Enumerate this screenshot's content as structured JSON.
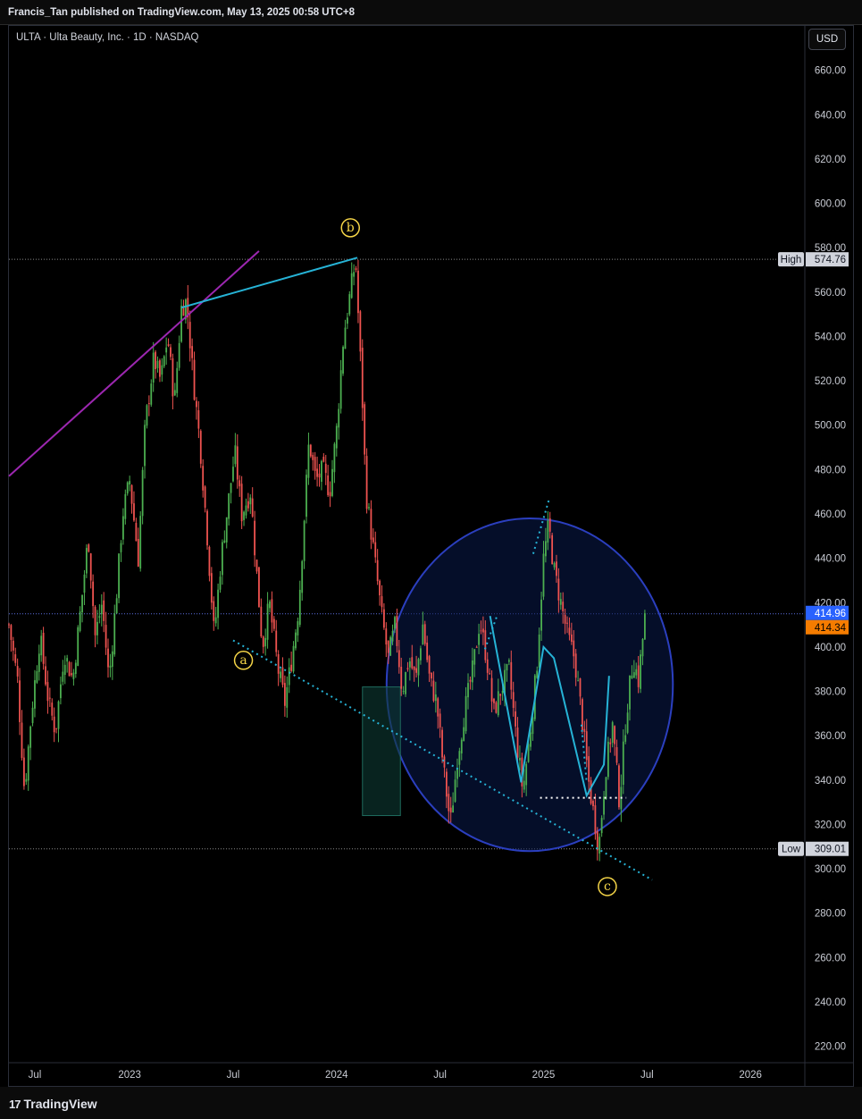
{
  "header": {
    "published_text": "Francis_Tan published on TradingView.com, May 13, 2025 00:58 UTC+8",
    "symbol_text": "ULTA · Ulta Beauty, Inc. · 1D · NASDAQ",
    "currency_button": "USD"
  },
  "footer": {
    "logo_text": "TradingView"
  },
  "chart_data": {
    "type": "candlestick",
    "symbol": "ULTA",
    "interval": "1D",
    "exchange": "NASDAQ",
    "y_ticks": [
      660,
      640,
      620,
      600,
      580,
      560,
      540,
      520,
      500,
      480,
      460,
      440,
      420,
      400,
      380,
      360,
      340,
      320,
      300,
      280,
      260,
      240,
      220
    ],
    "y_tick_labels": [
      "660.00",
      "640.00",
      "620.00",
      "600.00",
      "580.00",
      "560.00",
      "540.00",
      "520.00",
      "500.00",
      "480.00",
      "460.00",
      "440.00",
      "420.00",
      "400.00",
      "380.00",
      "360.00",
      "340.00",
      "320.00",
      "300.00",
      "280.00",
      "260.00",
      "240.00",
      "220.00"
    ],
    "x_tick_labels": [
      "Jul",
      "2023",
      "Jul",
      "2024",
      "Jul",
      "2025",
      "Jul",
      "2026"
    ],
    "x_ticks_months": [
      6.5,
      12,
      18,
      24,
      30,
      36,
      42,
      48
    ],
    "ylim": [
      213,
      680
    ],
    "xlim_months": [
      5.0,
      51.1
    ],
    "high": {
      "label": "High",
      "value": 574.76,
      "value_text": "574.76"
    },
    "low": {
      "label": "Low",
      "value": 309.01,
      "value_text": "309.01"
    },
    "last_price": {
      "value": 414.96,
      "value_text": "414.96",
      "color": "#2962ff"
    },
    "prev_close": {
      "value": 414.34,
      "value_text": "414.34",
      "color": "#f57c00"
    },
    "price_path": [
      [
        5.0,
        410
      ],
      [
        5.5,
        385
      ],
      [
        5.9,
        335
      ],
      [
        6.3,
        370
      ],
      [
        6.8,
        405
      ],
      [
        7.3,
        375
      ],
      [
        7.7,
        362
      ],
      [
        8.2,
        398
      ],
      [
        8.7,
        385
      ],
      [
        9.2,
        420
      ],
      [
        9.6,
        450
      ],
      [
        10.0,
        405
      ],
      [
        10.4,
        420
      ],
      [
        10.8,
        385
      ],
      [
        11.2,
        420
      ],
      [
        11.6,
        460
      ],
      [
        12.0,
        475
      ],
      [
        12.5,
        440
      ],
      [
        12.9,
        500
      ],
      [
        13.4,
        530
      ],
      [
        13.8,
        520
      ],
      [
        14.2,
        540
      ],
      [
        14.6,
        510
      ],
      [
        15.0,
        553
      ],
      [
        15.3,
        556
      ],
      [
        15.7,
        520
      ],
      [
        16.1,
        490
      ],
      [
        16.5,
        450
      ],
      [
        16.9,
        405
      ],
      [
        17.3,
        440
      ],
      [
        17.8,
        470
      ],
      [
        18.1,
        488
      ],
      [
        18.5,
        460
      ],
      [
        19.0,
        470
      ],
      [
        19.3,
        440
      ],
      [
        19.7,
        400
      ],
      [
        20.1,
        420
      ],
      [
        20.6,
        390
      ],
      [
        21.0,
        375
      ],
      [
        21.4,
        395
      ],
      [
        21.8,
        418
      ],
      [
        22.4,
        493
      ],
      [
        22.8,
        475
      ],
      [
        23.2,
        480
      ],
      [
        23.6,
        470
      ],
      [
        24.0,
        498
      ],
      [
        24.4,
        540
      ],
      [
        24.9,
        565
      ],
      [
        25.1,
        574.76
      ],
      [
        25.5,
        510
      ],
      [
        25.7,
        470
      ],
      [
        26.2,
        440
      ],
      [
        26.6,
        415
      ],
      [
        27.0,
        395
      ],
      [
        27.4,
        410
      ],
      [
        27.8,
        380
      ],
      [
        28.2,
        395
      ],
      [
        28.6,
        385
      ],
      [
        29.0,
        410
      ],
      [
        29.4,
        385
      ],
      [
        29.8,
        375
      ],
      [
        30.2,
        345
      ],
      [
        30.6,
        320
      ],
      [
        31.0,
        350
      ],
      [
        31.4,
        370
      ],
      [
        31.9,
        390
      ],
      [
        32.3,
        412
      ],
      [
        32.7,
        395
      ],
      [
        33.1,
        370
      ],
      [
        33.5,
        380
      ],
      [
        34.0,
        390
      ],
      [
        34.4,
        360
      ],
      [
        34.8,
        335
      ],
      [
        35.2,
        360
      ],
      [
        35.6,
        390
      ],
      [
        36.0,
        440
      ],
      [
        36.3,
        455
      ],
      [
        36.6,
        435
      ],
      [
        37.0,
        420
      ],
      [
        37.4,
        405
      ],
      [
        37.8,
        395
      ],
      [
        38.2,
        370
      ],
      [
        38.6,
        340
      ],
      [
        39.0,
        320
      ],
      [
        39.2,
        309.01
      ],
      [
        39.6,
        345
      ],
      [
        40.0,
        365
      ],
      [
        40.4,
        330
      ],
      [
        40.8,
        370
      ],
      [
        41.2,
        395
      ],
      [
        41.5,
        385
      ],
      [
        41.9,
        414.96
      ]
    ],
    "trendlines": [
      {
        "name": "purple-channel",
        "from": [
          5.0,
          477
        ],
        "to": [
          19.5,
          578.5
        ],
        "color": "#9c27b0"
      },
      {
        "name": "wave-b-upper",
        "from": [
          15.0,
          553
        ],
        "to": [
          25.2,
          575.5
        ],
        "color": "#26b3d6"
      },
      {
        "name": "wave-a-lower",
        "from": [
          18.0,
          403
        ],
        "to": [
          42.3,
          295
        ],
        "color": "#26b3d6",
        "dashed": true
      },
      {
        "name": "ending-diagonal-upper",
        "from": [
          35.4,
          442
        ],
        "to": [
          36.3,
          466
        ],
        "color": "#26b3d6",
        "dashed": true
      },
      {
        "name": "ending-diagonal-lower",
        "from": [
          38.2,
          365
        ],
        "to": [
          38.5,
          339
        ],
        "color": "#26b3d6",
        "dashed": true
      },
      {
        "name": "mini-wave-1",
        "from": [
          32.6,
          399
        ],
        "to": [
          33.3,
          414
        ],
        "color": "#26b3d6",
        "dashed": true
      },
      {
        "name": "support-line",
        "from": [
          35.8,
          332
        ],
        "to": [
          40.8,
          332
        ],
        "color": "#ffffff",
        "dashed": true
      }
    ],
    "zigzag": [
      [
        32.9,
        414
      ],
      [
        34.7,
        339
      ],
      [
        36.0,
        400
      ],
      [
        36.6,
        395
      ],
      [
        38.5,
        333
      ],
      [
        39.5,
        347
      ],
      [
        39.8,
        387
      ]
    ],
    "waves": [
      {
        "label": "a",
        "x": 18.6,
        "y": 394
      },
      {
        "label": "b",
        "x": 24.8,
        "y": 589
      },
      {
        "label": "c",
        "x": 39.7,
        "y": 292
      }
    ],
    "circle": {
      "cx": 35.2,
      "cy": 383,
      "rx_months": 8.3,
      "ry": 75
    },
    "volume_profile_box": {
      "x0": 25.5,
      "x1": 27.7,
      "top": 382,
      "bottom": 324
    }
  }
}
